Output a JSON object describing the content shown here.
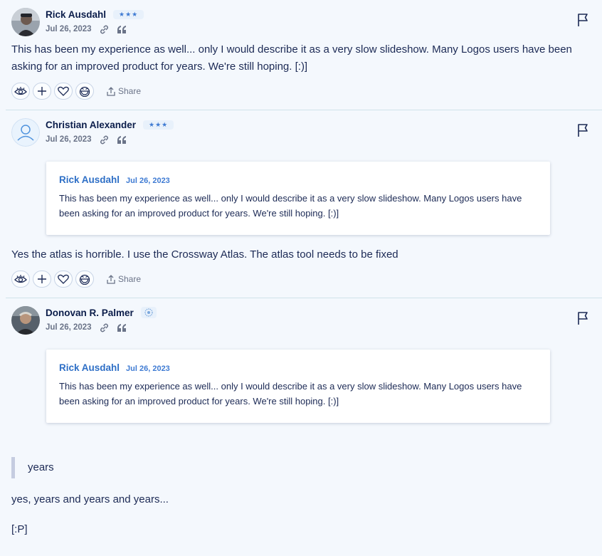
{
  "posts": [
    {
      "author": "Rick Ausdahl",
      "badge": "★★★",
      "date": "Jul 26, 2023",
      "body": "This has been my experience as well... only I would describe it as a very slow slideshow.  Many Logos users have been asking for an improved product for years.  We're still hoping.  [:)]",
      "share_label": "Share",
      "icons": [
        "eye-icon",
        "plus-icon",
        "heart-icon",
        "laugh-icon"
      ]
    },
    {
      "author": "Christian Alexander",
      "badge": "★★★",
      "date": "Jul 26, 2023",
      "quote": {
        "author": "Rick Ausdahl",
        "date": "Jul 26, 2023",
        "text": "This has been my experience as well... only I would describe it as a very slow slideshow.  Many Logos users have been asking for an improved product for years.  We're still hoping.  [:)]"
      },
      "body": "Yes the atlas is horrible. I use the Crossway Atlas. The atlas tool needs to be fixed",
      "share_label": "Share"
    },
    {
      "author": "Donovan R. Palmer",
      "date": "Jul 26, 2023",
      "quote": {
        "author": "Rick Ausdahl",
        "date": "Jul 26, 2023",
        "text": "This has been my experience as well... only I would describe it as a very slow slideshow.  Many Logos users have been asking for an improved product for years.  We're still hoping.  [:)]"
      },
      "blockquote": "years",
      "body_lines": [
        "yes, years and years and years...",
        "[:P]"
      ]
    }
  ],
  "colors": {
    "background": "#f4f8fd",
    "text": "#1c2a55",
    "link": "#2e6fc6",
    "badge_bg": "#e8f1fb"
  }
}
